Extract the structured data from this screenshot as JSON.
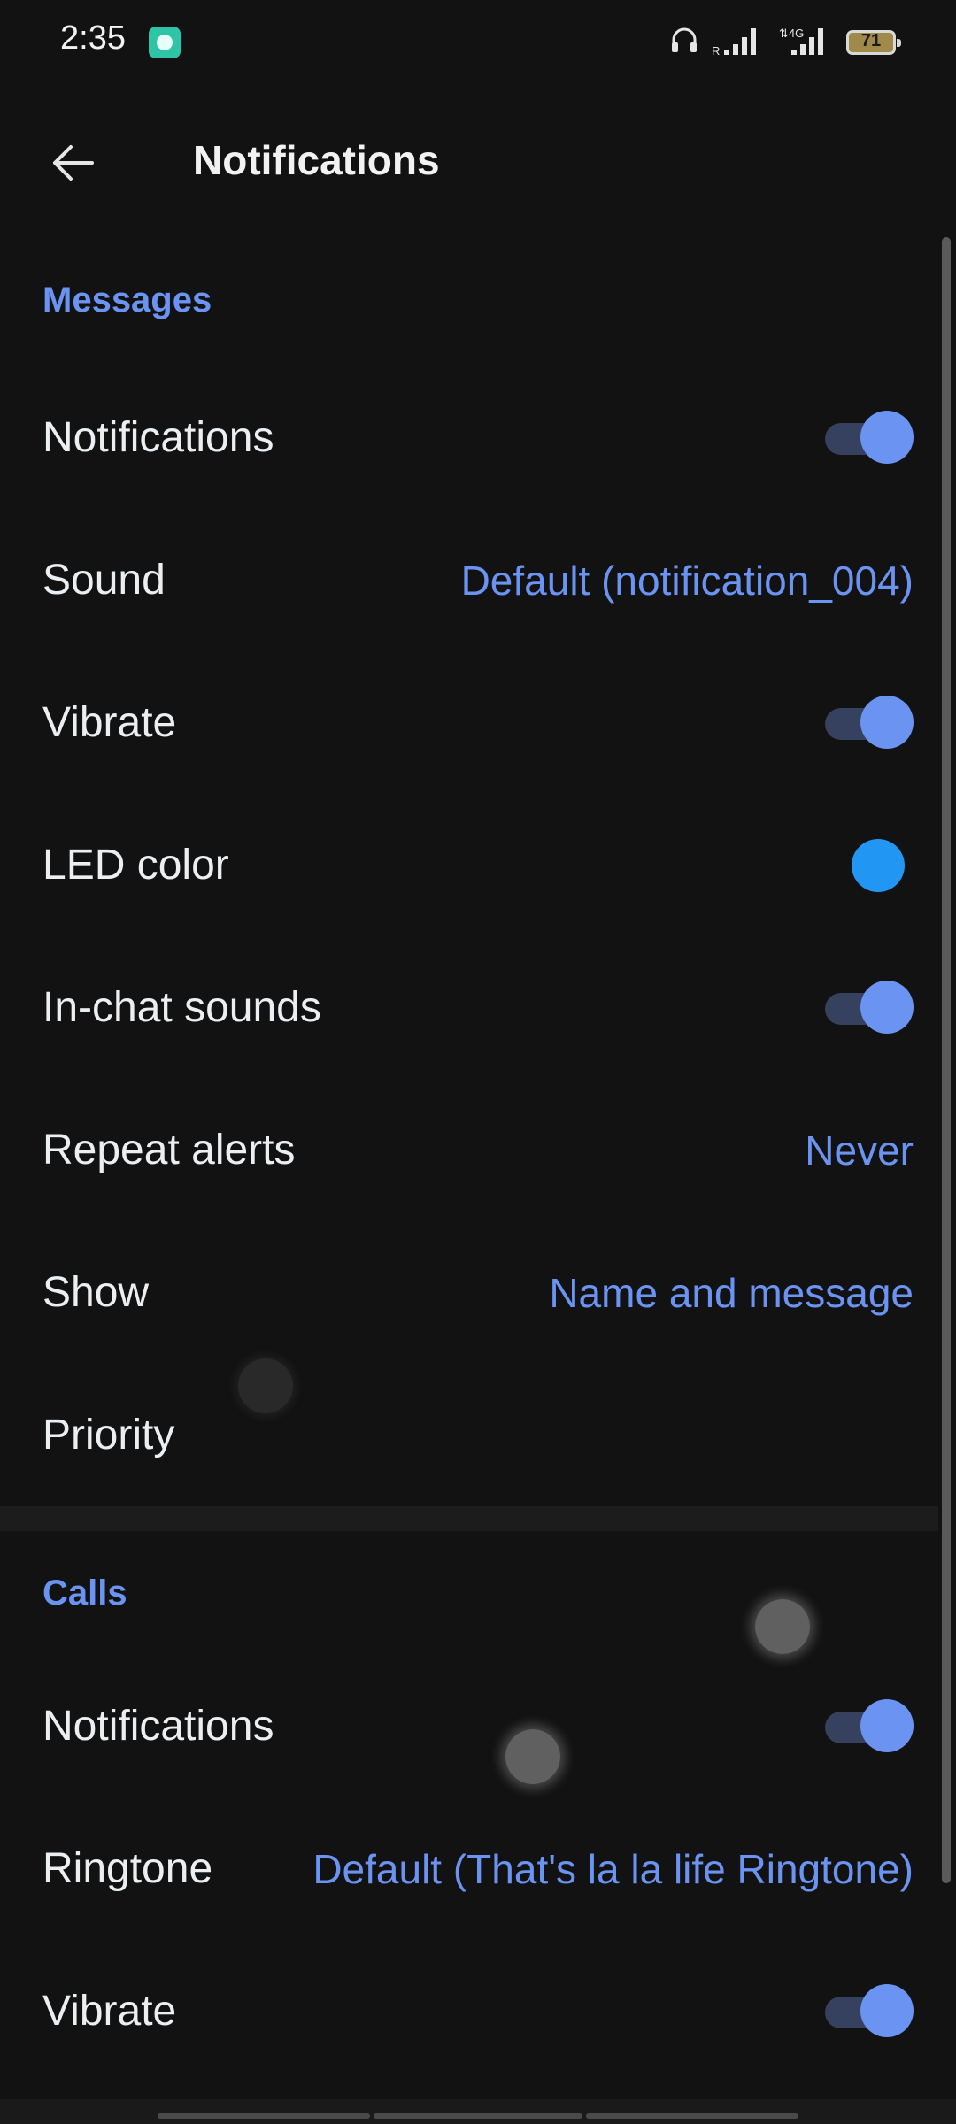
{
  "status_bar": {
    "time": "2:35",
    "battery": "71",
    "network": "4G",
    "roaming": "R"
  },
  "header": {
    "title": "Notifications"
  },
  "sections": {
    "messages": {
      "title": "Messages",
      "rows": {
        "notifications": {
          "label": "Notifications",
          "toggle": true
        },
        "sound": {
          "label": "Sound",
          "value": "Default (notification_004)"
        },
        "vibrate": {
          "label": "Vibrate",
          "toggle": true
        },
        "led_color": {
          "label": "LED color",
          "color": "#2196f3"
        },
        "in_chat_sounds": {
          "label": "In-chat sounds",
          "toggle": true
        },
        "repeat_alerts": {
          "label": "Repeat alerts",
          "value": "Never"
        },
        "show": {
          "label": "Show",
          "value": "Name and message"
        },
        "priority": {
          "label": "Priority"
        }
      }
    },
    "calls": {
      "title": "Calls",
      "rows": {
        "notifications": {
          "label": "Notifications",
          "toggle": true
        },
        "ringtone": {
          "label": "Ringtone",
          "value": "Default (That's la la life Ringtone)"
        },
        "vibrate": {
          "label": "Vibrate",
          "toggle": true
        }
      }
    }
  },
  "colors": {
    "accent": "#6b93f2",
    "background": "#121212",
    "led": "#2196f3"
  }
}
